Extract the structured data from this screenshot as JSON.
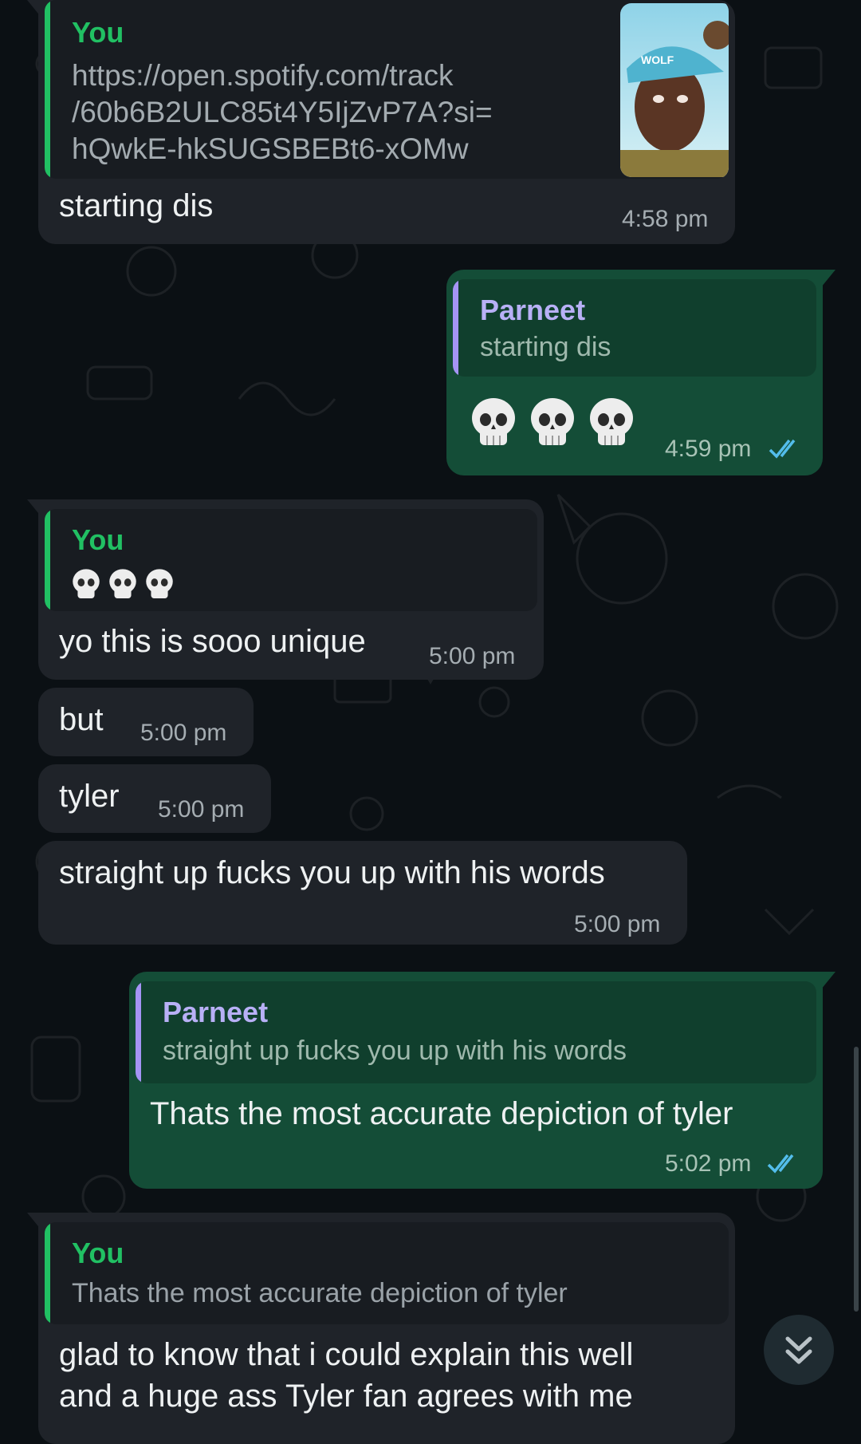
{
  "chat": {
    "messages": [
      {
        "quote_author": "You",
        "quote_text": "https://open.spotify.com/track\n/60b6B2ULC85t4Y5IjZvP7A?si=\nhQwkE-hkSUGSBEBt6-xOMw",
        "text": "starting dis",
        "time": "4:58 pm",
        "thumbnail": "album-art-image"
      },
      {
        "quote_author": "Parneet",
        "quote_text": "starting dis",
        "text": "💀💀💀",
        "time": "4:59 pm",
        "status": "read-double-check-icon"
      },
      {
        "quote_author": "You",
        "quote_text": "💀💀💀",
        "text": "yo this is sooo unique",
        "time": "5:00 pm"
      },
      {
        "text": "but",
        "time": "5:00 pm"
      },
      {
        "text": "tyler",
        "time": "5:00 pm"
      },
      {
        "text": "straight up fucks you up with his words",
        "time": "5:00 pm"
      },
      {
        "quote_author": "Parneet",
        "quote_text": "straight up fucks you up with his words",
        "text": "Thats the most accurate depiction of tyler",
        "time": "5:02 pm",
        "status": "read-double-check-icon"
      },
      {
        "quote_author": "You",
        "quote_text": "Thats the most accurate depiction of tyler",
        "text_line1": "glad to know that i could explain this well",
        "text_line2": "and a huge ass Tyler fan agrees with me"
      }
    ],
    "scroll_to_bottom_icon": "double-chevron-down-icon"
  },
  "colors": {
    "background": "#0b1014",
    "incoming_bubble": "#1f2329",
    "outgoing_bubble": "#144d37",
    "accent_green": "#21c063",
    "accent_purple": "#b8b0f6",
    "read_ticks": "#53bdeb"
  }
}
